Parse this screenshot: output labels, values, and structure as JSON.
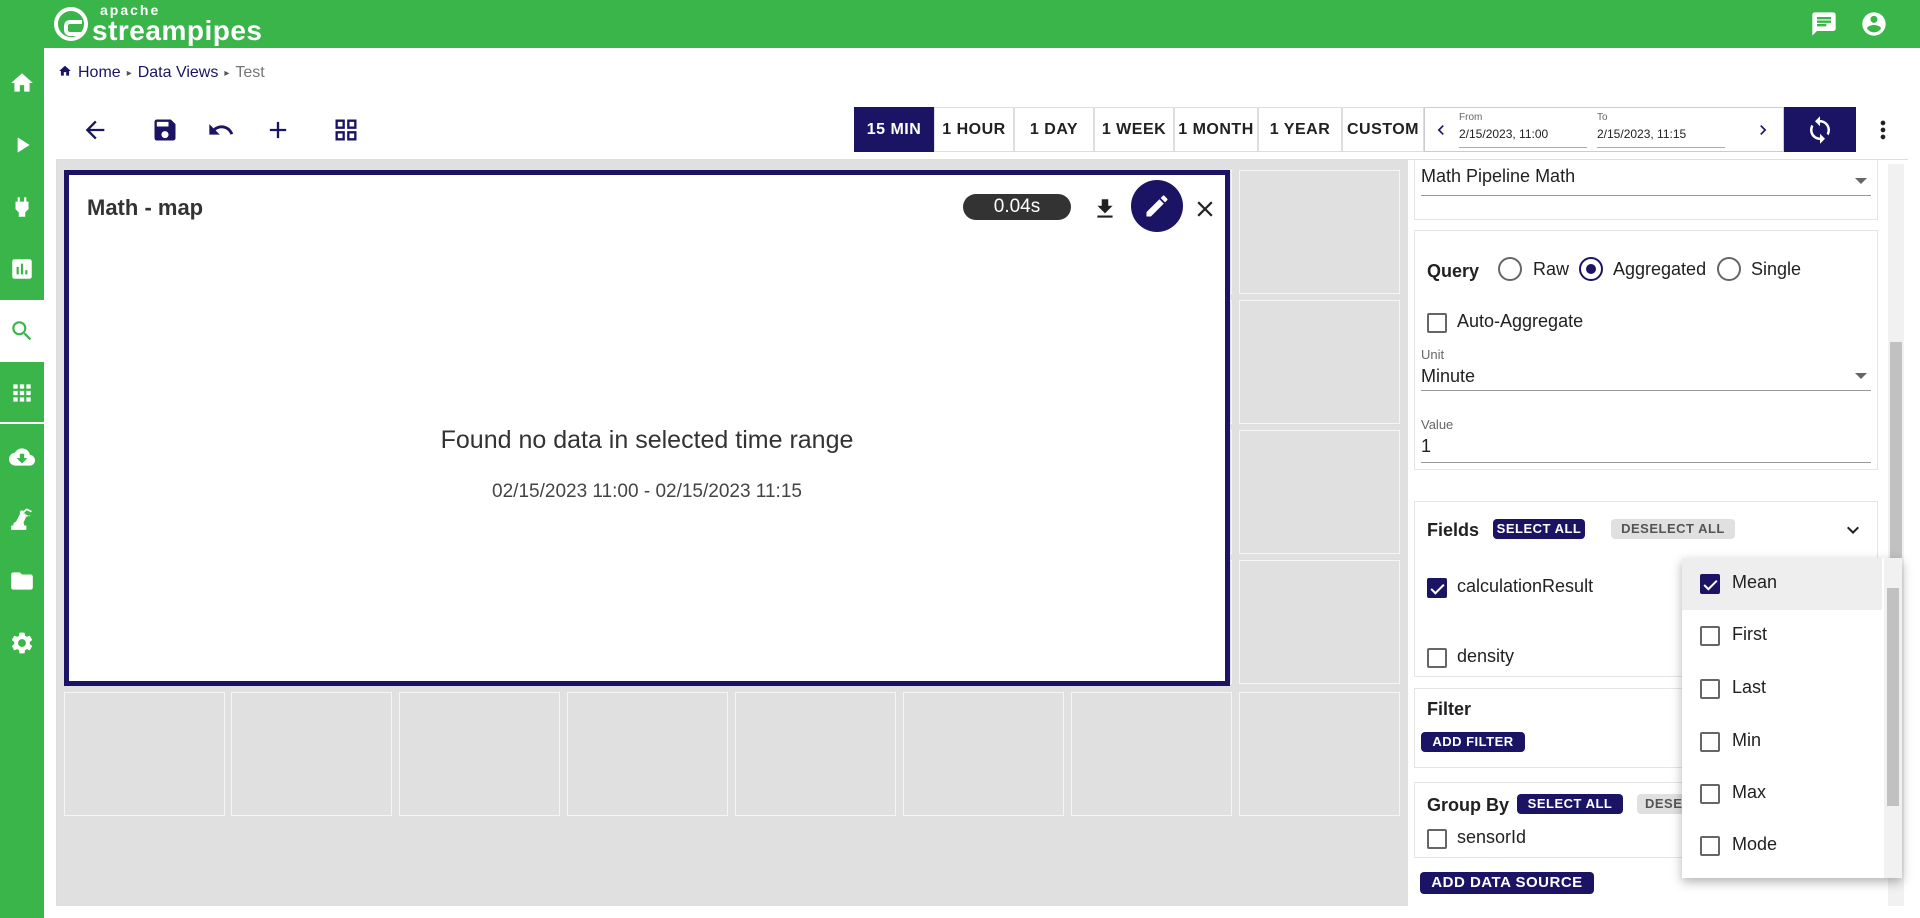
{
  "app": {
    "logo_top": "apache",
    "logo_main": "streampipes"
  },
  "breadcrumb": {
    "home": "Home",
    "data_views": "Data Views",
    "current": "Test"
  },
  "time_ranges": [
    {
      "label": "15 MIN",
      "selected": true
    },
    {
      "label": "1 HOUR",
      "selected": false
    },
    {
      "label": "1 DAY",
      "selected": false
    },
    {
      "label": "1 WEEK",
      "selected": false
    },
    {
      "label": "1 MONTH",
      "selected": false
    },
    {
      "label": "1 YEAR",
      "selected": false
    },
    {
      "label": "CUSTOM",
      "selected": false
    }
  ],
  "date_range": {
    "from_label": "From",
    "from_value": "2/15/2023, 11:00",
    "to_label": "To",
    "to_value": "2/15/2023, 11:15"
  },
  "widget": {
    "title": "Math - map",
    "timing": "0.04s",
    "empty_message": "Found no data in selected time range",
    "empty_range": "02/15/2023 11:00 - 02/15/2023 11:15"
  },
  "panel": {
    "pipeline": "Math Pipeline  Math",
    "query_label": "Query",
    "query_options": [
      "Raw",
      "Aggregated",
      "Single"
    ],
    "query_selected": "Aggregated",
    "auto_aggregate": "Auto-Aggregate",
    "unit_label": "Unit",
    "unit_value": "Minute",
    "value_label": "Value",
    "value_value": "1",
    "fields_label": "Fields",
    "select_all": "SELECT ALL",
    "deselect_all": "DESELECT ALL",
    "fields": [
      {
        "name": "calculationResult",
        "checked": true
      },
      {
        "name": "density",
        "checked": false
      }
    ],
    "filter_label": "Filter",
    "add_filter": "ADD FILTER",
    "group_by_label": "Group By",
    "group_select_all": "SELECT ALL",
    "group_deselect_partial": "DESE",
    "group_by_fields": [
      "sensorId"
    ],
    "add_data_source": "ADD DATA SOURCE"
  },
  "aggregation_dropdown": [
    {
      "label": "Mean",
      "checked": true
    },
    {
      "label": "First",
      "checked": false
    },
    {
      "label": "Last",
      "checked": false
    },
    {
      "label": "Min",
      "checked": false
    },
    {
      "label": "Max",
      "checked": false
    },
    {
      "label": "Mode",
      "checked": false
    }
  ]
}
